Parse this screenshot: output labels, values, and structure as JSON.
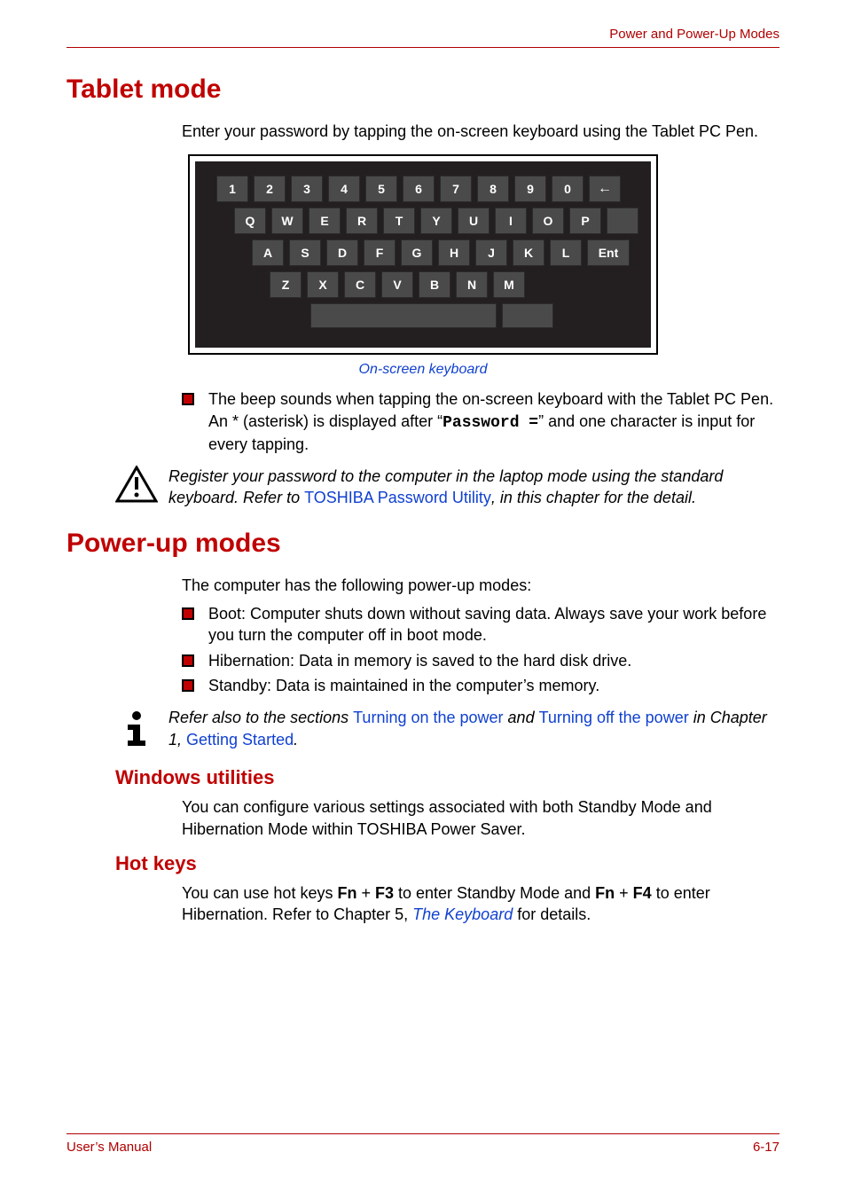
{
  "header": {
    "chapter_title": "Power and Power-Up Modes"
  },
  "s1": {
    "title": "Tablet mode",
    "intro": "Enter your password by tapping the on-screen keyboard using the Tablet PC Pen.",
    "caption": "On-screen keyboard",
    "bullet_pre": "The beep sounds when tapping the on-screen keyboard with the Tablet PC Pen. An * (asterisk) is displayed after “",
    "bullet_code": "Password =",
    "bullet_post": "” and one character is input for every tapping.",
    "warn_pre": "Register your password to the computer in the laptop mode using the standard keyboard. Refer to ",
    "warn_link": "TOSHIBA Password Utility",
    "warn_post": ", in this chapter for the detail."
  },
  "keyboard": {
    "row1": [
      "1",
      "2",
      "3",
      "4",
      "5",
      "6",
      "7",
      "8",
      "9",
      "0",
      "←"
    ],
    "row2": [
      "Q",
      "W",
      "E",
      "R",
      "T",
      "Y",
      "U",
      "I",
      "O",
      "P",
      ""
    ],
    "row3": [
      "A",
      "S",
      "D",
      "F",
      "G",
      "H",
      "J",
      "K",
      "L",
      "Ent"
    ],
    "row4": [
      "Z",
      "X",
      "C",
      "V",
      "B",
      "N",
      "M"
    ]
  },
  "s2": {
    "title": "Power-up modes",
    "intro": "The computer has the following power-up modes:",
    "b1": "Boot: Computer shuts down without saving data. Always save your work before you turn the computer off in boot mode.",
    "b2": "Hibernation: Data in memory is saved to the hard disk drive.",
    "b3": "Standby: Data is maintained in the computer’s memory.",
    "info_pre": "Refer also to the sections ",
    "info_l1": "Turning on the power",
    "info_mid": " and ",
    "info_l2": "Turning off the power",
    "info_post_pre": " in Chapter 1, ",
    "info_l3": "Getting Started",
    "info_end": "."
  },
  "s3": {
    "title": "Windows utilities",
    "body": "You can configure various settings associated with both Standby Mode and Hibernation Mode within TOSHIBA Power Saver."
  },
  "s4": {
    "title": "Hot keys",
    "pre": "You can use hot keys ",
    "k1": "Fn",
    "plus": " + ",
    "k2": "F3",
    "mid1": " to enter Standby Mode and ",
    "k3": "Fn",
    "k4": "F4",
    "mid2": " to enter Hibernation. Refer to Chapter 5, ",
    "link": "The Keyboard",
    "end": " for details."
  },
  "footer": {
    "left": "User’s Manual",
    "right": "6-17"
  }
}
